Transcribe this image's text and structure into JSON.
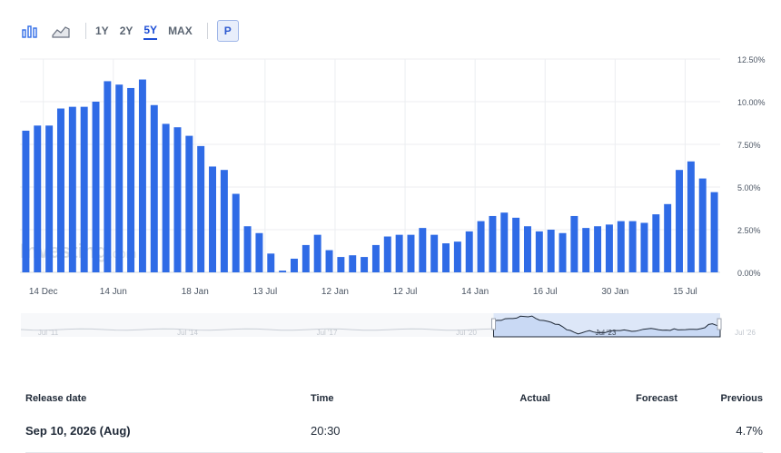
{
  "toolbar": {
    "icons": [
      "bar-chart-icon",
      "area-chart-icon"
    ],
    "ranges": [
      "1Y",
      "2Y",
      "5Y",
      "MAX"
    ],
    "active_range": "5Y",
    "p_label": "P"
  },
  "watermark": {
    "text": "Investing",
    "suffix": ".com"
  },
  "chart_data": {
    "type": "bar",
    "y_ticks": [
      "0.00%",
      "2.50%",
      "5.00%",
      "7.50%",
      "10.00%",
      "12.50%"
    ],
    "ylim": [
      0,
      12.5
    ],
    "grid": true,
    "x_ticks": [
      {
        "label": "14 Dec",
        "index": 1.5
      },
      {
        "label": "14 Jun",
        "index": 7.5
      },
      {
        "label": "18 Jan",
        "index": 14.5
      },
      {
        "label": "13 Jul",
        "index": 20.5
      },
      {
        "label": "12 Jan",
        "index": 26.5
      },
      {
        "label": "12 Jul",
        "index": 32.5
      },
      {
        "label": "14 Jan",
        "index": 38.5
      },
      {
        "label": "16 Jul",
        "index": 44.5
      },
      {
        "label": "30 Jan",
        "index": 50.5
      },
      {
        "label": "15 Jul",
        "index": 56.5
      }
    ],
    "values": [
      8.3,
      8.6,
      8.6,
      9.6,
      9.7,
      9.7,
      10.0,
      11.2,
      11.0,
      10.8,
      11.3,
      9.8,
      8.7,
      8.5,
      8.0,
      7.4,
      6.2,
      6.0,
      4.6,
      2.7,
      2.3,
      1.1,
      0.1,
      0.8,
      1.6,
      2.2,
      1.3,
      0.9,
      1.0,
      0.9,
      1.6,
      2.1,
      2.2,
      2.2,
      2.6,
      2.2,
      1.7,
      1.8,
      2.4,
      3.0,
      3.3,
      3.5,
      3.2,
      2.7,
      2.4,
      2.5,
      2.3,
      3.3,
      2.6,
      2.7,
      2.8,
      3.0,
      3.0,
      2.9,
      3.4,
      4.0,
      6.0,
      6.5,
      5.5,
      4.7
    ],
    "bar_color": "#2f6be6"
  },
  "navigator": {
    "labels": [
      "Jul '11",
      "Jul '14",
      "Jul '17",
      "Jul '20",
      "Jul '23",
      "Jul '26"
    ],
    "selected_from_fraction": 0.676,
    "selected_to_fraction": 1.0
  },
  "table": {
    "headers": {
      "release_date": "Release date",
      "time": "Time",
      "actual": "Actual",
      "forecast": "Forecast",
      "previous": "Previous"
    },
    "rows": [
      {
        "release_date": "Sep 10, 2026 (Aug)",
        "time": "20:30",
        "actual": "",
        "forecast": "",
        "previous": "4.7%"
      }
    ]
  }
}
